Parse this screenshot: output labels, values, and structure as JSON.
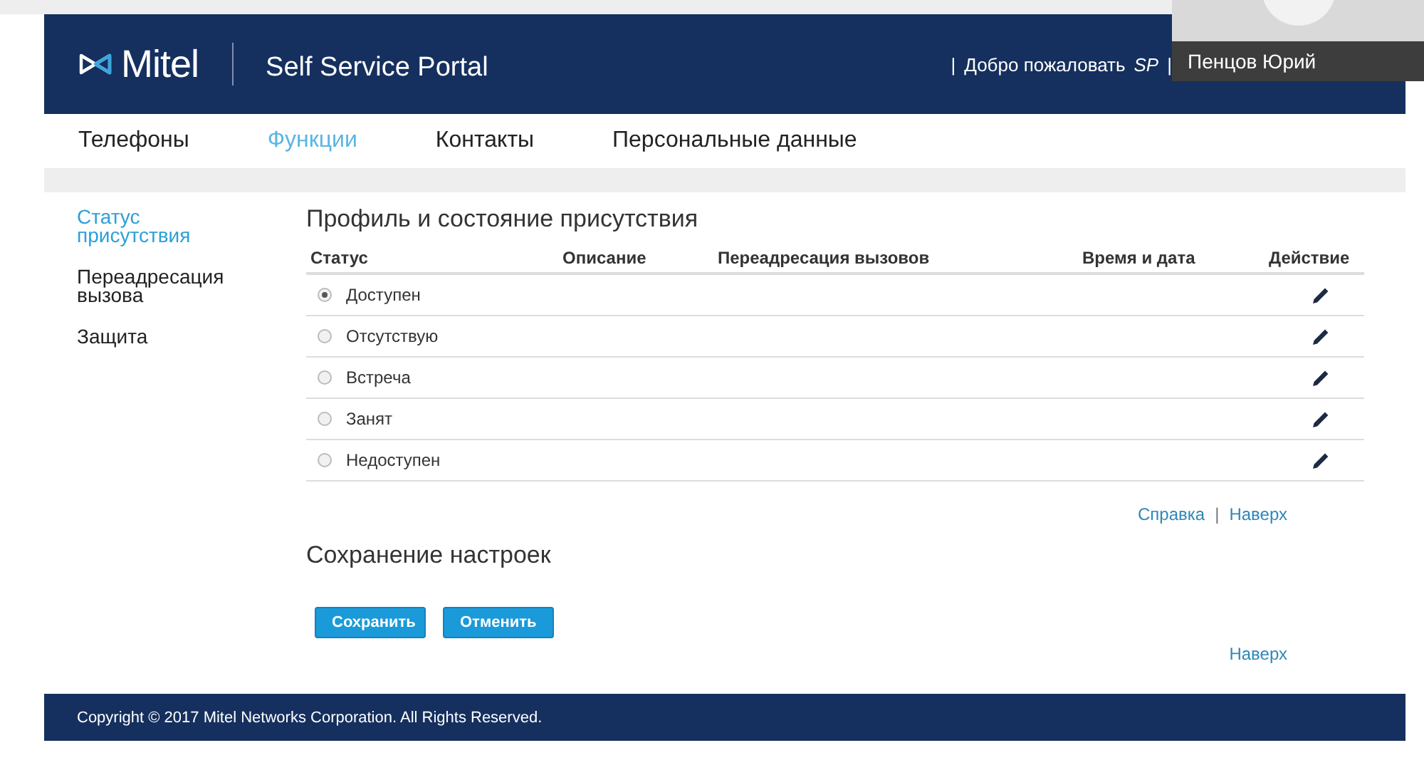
{
  "header": {
    "logo": "Mitel",
    "title": "Self Service Portal",
    "sep_left": "|",
    "welcome": "Добро пожаловать",
    "user": "SP",
    "sep_right": "|"
  },
  "nav": [
    {
      "label": "Телефоны",
      "selected": false
    },
    {
      "label": "Функции",
      "selected": true
    },
    {
      "label": "Контакты",
      "selected": false
    },
    {
      "label": "Персональные данные",
      "selected": false
    }
  ],
  "sidebar": [
    {
      "label": "Статус присутствия",
      "selected": true
    },
    {
      "label": "Переадресация вызова",
      "selected": false
    },
    {
      "label": "Защита",
      "selected": false
    }
  ],
  "presence": {
    "title": "Профиль и состояние присутствия",
    "columns": [
      "Статус",
      "Описание",
      "Переадресация вызовов",
      "Время и дата",
      "Действие"
    ],
    "rows": [
      {
        "status": "Доступен",
        "selected": true
      },
      {
        "status": "Отсутствую",
        "selected": false
      },
      {
        "status": "Встреча",
        "selected": false
      },
      {
        "status": "Занят",
        "selected": false
      },
      {
        "status": "Недоступен",
        "selected": false
      }
    ],
    "links": [
      "Справка",
      "Наверх"
    ],
    "link_sep": "|"
  },
  "save": {
    "title": "Сохранение настроек",
    "buttons": [
      "Сохранить",
      "Отменить"
    ],
    "link": "Наверх"
  },
  "footer": "Copyright © 2017 Mitel Networks Corporation. All Rights Reserved.",
  "video_overlay": {
    "participant": "Пенцов Юрий"
  }
}
